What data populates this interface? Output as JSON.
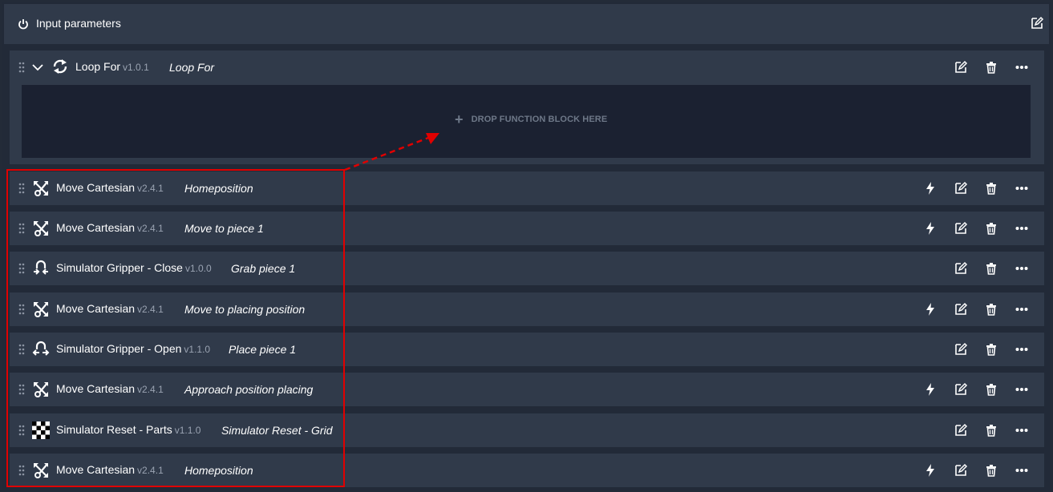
{
  "header": {
    "title": "Input parameters",
    "icon": "power-icon",
    "edit_icon": "edit-icon"
  },
  "loop": {
    "name": "Loop For",
    "version": "v1.0.1",
    "description": "Loop For",
    "drop_label": "DROP FUNCTION BLOCK HERE"
  },
  "blocks": [
    {
      "name": "Move Cartesian",
      "version": "v2.4.1",
      "description": "Homeposition",
      "icon": "move-cartesian-icon",
      "bolt": true
    },
    {
      "name": "Move Cartesian",
      "version": "v2.4.1",
      "description": "Move to piece 1",
      "icon": "move-cartesian-icon",
      "bolt": true
    },
    {
      "name": "Simulator Gripper - Close",
      "version": "v1.0.0",
      "description": "Grab piece 1",
      "icon": "gripper-close-icon",
      "bolt": false
    },
    {
      "name": "Move Cartesian",
      "version": "v2.4.1",
      "description": "Move to placing position",
      "icon": "move-cartesian-icon",
      "bolt": true
    },
    {
      "name": "Simulator Gripper - Open",
      "version": "v1.1.0",
      "description": "Place piece 1",
      "icon": "gripper-open-icon",
      "bolt": false
    },
    {
      "name": "Move Cartesian",
      "version": "v2.4.1",
      "description": "Approach position placing",
      "icon": "move-cartesian-icon",
      "bolt": true
    },
    {
      "name": "Simulator Reset - Parts",
      "version": "v1.1.0",
      "description": "Simulator Reset - Grid",
      "icon": "checkerboard-icon",
      "bolt": false
    },
    {
      "name": "Move Cartesian",
      "version": "v2.4.1",
      "description": "Homeposition",
      "icon": "move-cartesian-icon",
      "bolt": true
    }
  ],
  "colors": {
    "highlight": "#e00000",
    "panel": "#303a4a",
    "drop_zone": "#1b2131",
    "background": "#222a38"
  }
}
